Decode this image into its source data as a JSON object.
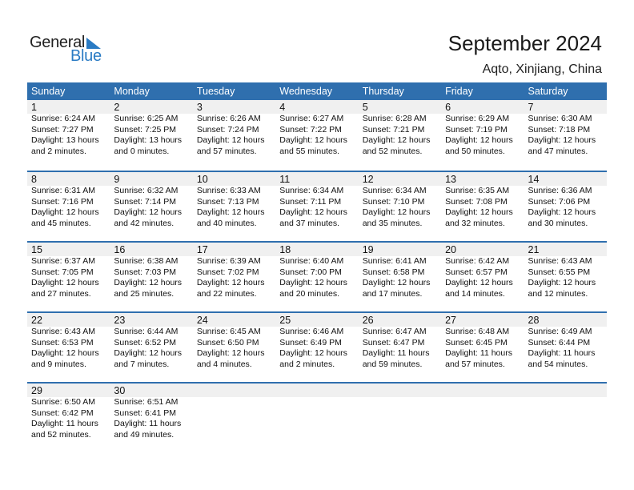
{
  "logo": {
    "word1": "General",
    "word2": "Blue",
    "accent": "#2a7bc4"
  },
  "header": {
    "title": "September 2024",
    "location": "Aqto, Xinjiang, China"
  },
  "colors": {
    "header_bg": "#2f6fae",
    "date_bg": "#f0f0f0"
  },
  "weekdays": [
    "Sunday",
    "Monday",
    "Tuesday",
    "Wednesday",
    "Thursday",
    "Friday",
    "Saturday"
  ],
  "weeks": [
    [
      {
        "day": "1",
        "sunrise": "Sunrise: 6:24 AM",
        "sunset": "Sunset: 7:27 PM",
        "daylight1": "Daylight: 13 hours",
        "daylight2": "and 2 minutes."
      },
      {
        "day": "2",
        "sunrise": "Sunrise: 6:25 AM",
        "sunset": "Sunset: 7:25 PM",
        "daylight1": "Daylight: 13 hours",
        "daylight2": "and 0 minutes."
      },
      {
        "day": "3",
        "sunrise": "Sunrise: 6:26 AM",
        "sunset": "Sunset: 7:24 PM",
        "daylight1": "Daylight: 12 hours",
        "daylight2": "and 57 minutes."
      },
      {
        "day": "4",
        "sunrise": "Sunrise: 6:27 AM",
        "sunset": "Sunset: 7:22 PM",
        "daylight1": "Daylight: 12 hours",
        "daylight2": "and 55 minutes."
      },
      {
        "day": "5",
        "sunrise": "Sunrise: 6:28 AM",
        "sunset": "Sunset: 7:21 PM",
        "daylight1": "Daylight: 12 hours",
        "daylight2": "and 52 minutes."
      },
      {
        "day": "6",
        "sunrise": "Sunrise: 6:29 AM",
        "sunset": "Sunset: 7:19 PM",
        "daylight1": "Daylight: 12 hours",
        "daylight2": "and 50 minutes."
      },
      {
        "day": "7",
        "sunrise": "Sunrise: 6:30 AM",
        "sunset": "Sunset: 7:18 PM",
        "daylight1": "Daylight: 12 hours",
        "daylight2": "and 47 minutes."
      }
    ],
    [
      {
        "day": "8",
        "sunrise": "Sunrise: 6:31 AM",
        "sunset": "Sunset: 7:16 PM",
        "daylight1": "Daylight: 12 hours",
        "daylight2": "and 45 minutes."
      },
      {
        "day": "9",
        "sunrise": "Sunrise: 6:32 AM",
        "sunset": "Sunset: 7:14 PM",
        "daylight1": "Daylight: 12 hours",
        "daylight2": "and 42 minutes."
      },
      {
        "day": "10",
        "sunrise": "Sunrise: 6:33 AM",
        "sunset": "Sunset: 7:13 PM",
        "daylight1": "Daylight: 12 hours",
        "daylight2": "and 40 minutes."
      },
      {
        "day": "11",
        "sunrise": "Sunrise: 6:34 AM",
        "sunset": "Sunset: 7:11 PM",
        "daylight1": "Daylight: 12 hours",
        "daylight2": "and 37 minutes."
      },
      {
        "day": "12",
        "sunrise": "Sunrise: 6:34 AM",
        "sunset": "Sunset: 7:10 PM",
        "daylight1": "Daylight: 12 hours",
        "daylight2": "and 35 minutes."
      },
      {
        "day": "13",
        "sunrise": "Sunrise: 6:35 AM",
        "sunset": "Sunset: 7:08 PM",
        "daylight1": "Daylight: 12 hours",
        "daylight2": "and 32 minutes."
      },
      {
        "day": "14",
        "sunrise": "Sunrise: 6:36 AM",
        "sunset": "Sunset: 7:06 PM",
        "daylight1": "Daylight: 12 hours",
        "daylight2": "and 30 minutes."
      }
    ],
    [
      {
        "day": "15",
        "sunrise": "Sunrise: 6:37 AM",
        "sunset": "Sunset: 7:05 PM",
        "daylight1": "Daylight: 12 hours",
        "daylight2": "and 27 minutes."
      },
      {
        "day": "16",
        "sunrise": "Sunrise: 6:38 AM",
        "sunset": "Sunset: 7:03 PM",
        "daylight1": "Daylight: 12 hours",
        "daylight2": "and 25 minutes."
      },
      {
        "day": "17",
        "sunrise": "Sunrise: 6:39 AM",
        "sunset": "Sunset: 7:02 PM",
        "daylight1": "Daylight: 12 hours",
        "daylight2": "and 22 minutes."
      },
      {
        "day": "18",
        "sunrise": "Sunrise: 6:40 AM",
        "sunset": "Sunset: 7:00 PM",
        "daylight1": "Daylight: 12 hours",
        "daylight2": "and 20 minutes."
      },
      {
        "day": "19",
        "sunrise": "Sunrise: 6:41 AM",
        "sunset": "Sunset: 6:58 PM",
        "daylight1": "Daylight: 12 hours",
        "daylight2": "and 17 minutes."
      },
      {
        "day": "20",
        "sunrise": "Sunrise: 6:42 AM",
        "sunset": "Sunset: 6:57 PM",
        "daylight1": "Daylight: 12 hours",
        "daylight2": "and 14 minutes."
      },
      {
        "day": "21",
        "sunrise": "Sunrise: 6:43 AM",
        "sunset": "Sunset: 6:55 PM",
        "daylight1": "Daylight: 12 hours",
        "daylight2": "and 12 minutes."
      }
    ],
    [
      {
        "day": "22",
        "sunrise": "Sunrise: 6:43 AM",
        "sunset": "Sunset: 6:53 PM",
        "daylight1": "Daylight: 12 hours",
        "daylight2": "and 9 minutes."
      },
      {
        "day": "23",
        "sunrise": "Sunrise: 6:44 AM",
        "sunset": "Sunset: 6:52 PM",
        "daylight1": "Daylight: 12 hours",
        "daylight2": "and 7 minutes."
      },
      {
        "day": "24",
        "sunrise": "Sunrise: 6:45 AM",
        "sunset": "Sunset: 6:50 PM",
        "daylight1": "Daylight: 12 hours",
        "daylight2": "and 4 minutes."
      },
      {
        "day": "25",
        "sunrise": "Sunrise: 6:46 AM",
        "sunset": "Sunset: 6:49 PM",
        "daylight1": "Daylight: 12 hours",
        "daylight2": "and 2 minutes."
      },
      {
        "day": "26",
        "sunrise": "Sunrise: 6:47 AM",
        "sunset": "Sunset: 6:47 PM",
        "daylight1": "Daylight: 11 hours",
        "daylight2": "and 59 minutes."
      },
      {
        "day": "27",
        "sunrise": "Sunrise: 6:48 AM",
        "sunset": "Sunset: 6:45 PM",
        "daylight1": "Daylight: 11 hours",
        "daylight2": "and 57 minutes."
      },
      {
        "day": "28",
        "sunrise": "Sunrise: 6:49 AM",
        "sunset": "Sunset: 6:44 PM",
        "daylight1": "Daylight: 11 hours",
        "daylight2": "and 54 minutes."
      }
    ],
    [
      {
        "day": "29",
        "sunrise": "Sunrise: 6:50 AM",
        "sunset": "Sunset: 6:42 PM",
        "daylight1": "Daylight: 11 hours",
        "daylight2": "and 52 minutes."
      },
      {
        "day": "30",
        "sunrise": "Sunrise: 6:51 AM",
        "sunset": "Sunset: 6:41 PM",
        "daylight1": "Daylight: 11 hours",
        "daylight2": "and 49 minutes."
      },
      {},
      {},
      {},
      {},
      {}
    ]
  ]
}
